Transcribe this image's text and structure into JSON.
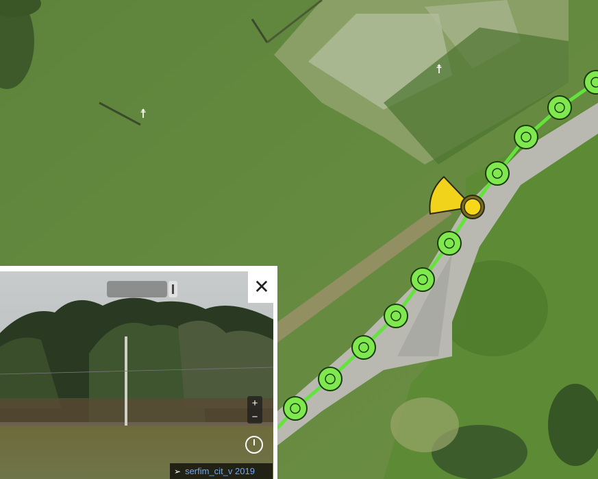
{
  "viewer": {
    "close_label": "✕",
    "zoom_in_label": "+",
    "zoom_out_label": "−",
    "attribution_user": "serfim_cit_v 2019"
  },
  "colors": {
    "track_line": "#63e33c",
    "track_marker_fill": "#7ee84e",
    "current_position": "#f7d71a",
    "view_cone": "#f2d31b"
  }
}
